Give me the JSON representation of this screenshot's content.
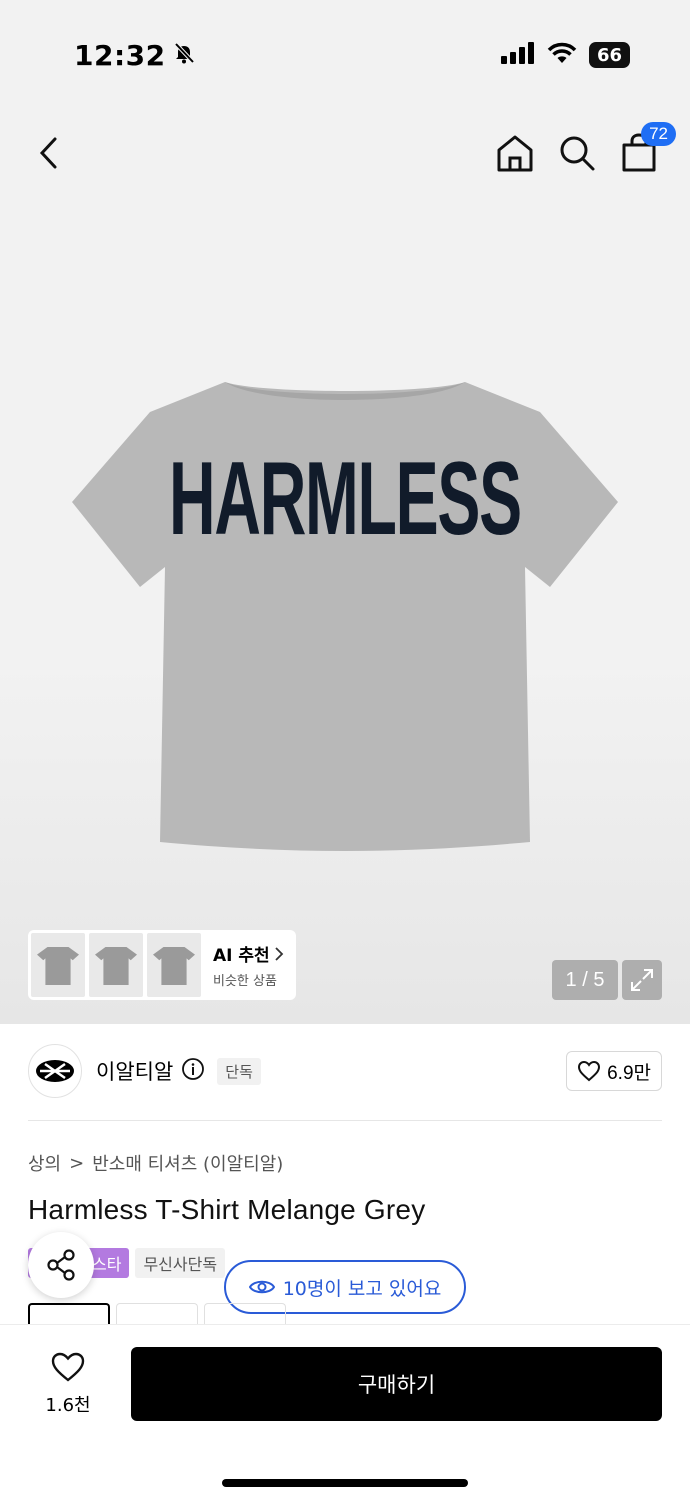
{
  "status_bar": {
    "time": "12:32",
    "battery": "66"
  },
  "nav": {
    "cart_count": "72"
  },
  "hero": {
    "print_text": "HARMLESS",
    "ai_card": {
      "title": "AI 추천",
      "subtitle": "비슷한 상품"
    },
    "page_indicator": "1 / 5"
  },
  "brand": {
    "name": "이알티알",
    "exclusive_tag": "단독",
    "likes": "6.9만"
  },
  "breadcrumb": {
    "category": "상의",
    "separator": ">",
    "subcategory": "반소매 티셔츠 (이알티알)"
  },
  "product": {
    "title": "Harmless T-Shirt Melange Grey"
  },
  "tags": {
    "purple": "스타",
    "gray": "무신사단독"
  },
  "viewers": {
    "text": "10명이 보고 있어요"
  },
  "bottom_bar": {
    "wish_count": "1.6천",
    "buy_label": "구매하기"
  },
  "colors": {
    "accent_blue": "#2a5bd7",
    "badge_blue": "#1f6ef4",
    "tag_purple": "#b37ae0",
    "tshirt_grey": "#b8b8b8",
    "print_navy": "#111b2a"
  }
}
